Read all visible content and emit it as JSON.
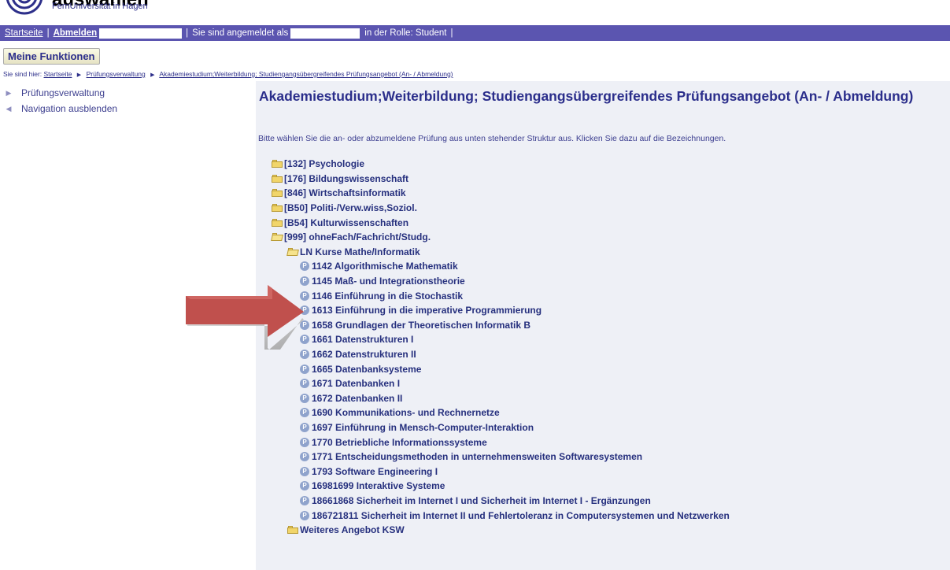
{
  "header": {
    "logo_title": "auswählen",
    "logo_subtitle": "FernUniversität in Hagen"
  },
  "topbar": {
    "home_link": "Startseite",
    "logout_link": "Abmelden",
    "logged_in_as": "Sie sind angemeldet als",
    "role_text": "in der Rolle: Student"
  },
  "functions_button": "Meine Funktionen",
  "breadcrumb": {
    "prefix": "Sie sind hier:",
    "items": [
      "Startseite",
      "Prüfungsverwaltung",
      "Akademiestudium;Weiterbildung; Studiengangsübergreifendes Prüfungsangebot (An- / Abmeldung)"
    ]
  },
  "sidebar": {
    "items": [
      {
        "label": "Prüfungsverwaltung",
        "icon": "triangle-right-icon"
      },
      {
        "label": "Navigation ausblenden",
        "icon": "arrow-left-icon"
      }
    ]
  },
  "main": {
    "title": "Akademiestudium;Weiterbildung; Studiengangsübergreifendes Prüfungsangebot (An- / Abmeldung)",
    "intro": "Bitte wählen Sie die an- oder abzumeldene Prüfung aus unten stehender Struktur aus. Klicken Sie dazu auf die Bezeichnungen."
  },
  "tree": {
    "folders": [
      "[132] Psychologie",
      "[176] Bildungswissenschaft",
      "[846] Wirtschaftsinformatik",
      "[B50] Politi-/Verw.wiss,Soziol.",
      "[B54] Kulturwissenschaften",
      "[999] ohneFach/Fachricht/Studg."
    ],
    "subfolder": "LN Kurse Mathe/Informatik",
    "courses": [
      "1142 Algorithmische Mathematik",
      "1145 Maß- und Integrationstheorie",
      "1146 Einführung in die Stochastik",
      "1613 Einführung in die imperative Programmierung",
      "1658 Grundlagen der Theoretischen Informatik B",
      "1661 Datenstrukturen I",
      "1662 Datenstrukturen II",
      "1665 Datenbanksysteme",
      "1671 Datenbanken I",
      "1672 Datenbanken II",
      "1690 Kommunikations- und Rechnernetze",
      "1697 Einführung in Mensch-Computer-Interaktion",
      "1770 Betriebliche Informationssysteme",
      "1771 Entscheidungsmethoden in unternehmensweiten Softwaresystemen",
      "1793 Software Engineering I",
      "16981699 Interaktive Systeme",
      "18661868 Sicherheit im Internet I und Sicherheit im Internet I - Ergänzungen",
      "186721811 Sicherheit im Internet II und Fehlertoleranz in Computersystemen und Netzwerken"
    ],
    "course_icon_glyph": "P",
    "last_folder": "Weiteres Angebot KSW"
  },
  "colors": {
    "topbar": "#5b55b0",
    "link_text": "#26307e",
    "main_bg": "#eef0f6",
    "annotation_arrow": "#c0504d"
  }
}
